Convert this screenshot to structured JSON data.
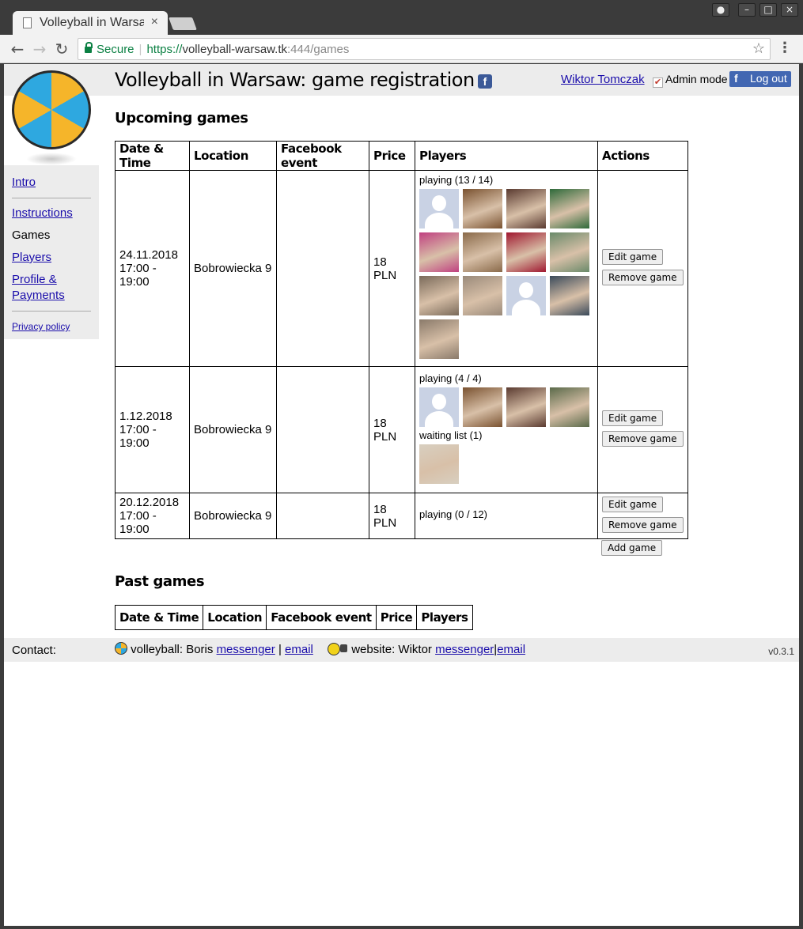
{
  "browser": {
    "tab_title": "Volleyball in Warsaw",
    "tab_close": "×",
    "secure_label": "Secure",
    "url_scheme": "https://",
    "url_host": "volleyball-warsaw.tk",
    "url_rest": ":444/games"
  },
  "header": {
    "title": "Volleyball in Warsaw: game registration",
    "fb_glyph": "f",
    "user_name": "Wiktor Tomczak",
    "admin_mode_label": "Admin mode",
    "admin_mode_checked": true,
    "logout_label": "Log out"
  },
  "sidebar": {
    "items": [
      {
        "label": "Intro"
      },
      {
        "label": "Instructions"
      },
      {
        "label": "Games"
      },
      {
        "label": "Players"
      },
      {
        "label": "Profile &"
      },
      {
        "label": "Payments"
      },
      {
        "label": "Privacy policy"
      }
    ]
  },
  "upcoming": {
    "title": "Upcoming games",
    "columns": [
      "Date & Time",
      "Location",
      "Facebook event",
      "Price",
      "Players",
      "Actions"
    ],
    "games": [
      {
        "date": "24.11.2018",
        "time": "17:00 - 19:00",
        "location": "Bobrowiecka 9",
        "facebook_event": "",
        "price": "18 PLN",
        "playing_label": "playing (13 / 14)",
        "avatars": [
          "#c9d2e4",
          "#7a5230",
          "#5a3a30",
          "#2e6a3a",
          "#c04080",
          "#8a6a4a",
          "#a01830",
          "#6a8a6a",
          "#7a6a5a",
          "#9a8a7a",
          "#c9d2e4",
          "#3a4a5a",
          "#8a7a6a"
        ],
        "edit_label": "Edit game",
        "remove_label": "Remove game"
      },
      {
        "date": "1.12.2018",
        "time": "17:00 - 19:00",
        "location": "Bobrowiecka 9",
        "facebook_event": "",
        "price": "18 PLN",
        "playing_label": "playing (4 / 4)",
        "avatars": [
          "#c9d2e4",
          "#7a5230",
          "#5a3a30",
          "#5a6a4a"
        ],
        "waiting_label": "waiting list (1)",
        "waiting_avatars": [
          "#d8cfc0"
        ],
        "edit_label": "Edit game",
        "remove_label": "Remove game"
      },
      {
        "date": "20.12.2018",
        "time": "17:00 - 19:00",
        "location": "Bobrowiecka 9",
        "facebook_event": "",
        "price": "18 PLN",
        "playing_label": "playing (0 / 12)",
        "avatars": [],
        "edit_label": "Edit game",
        "remove_label": "Remove game"
      }
    ],
    "add_game_label": "Add game"
  },
  "past": {
    "title": "Past games",
    "columns": [
      "Date & Time",
      "Location",
      "Facebook event",
      "Price",
      "Players"
    ]
  },
  "footer": {
    "contact_label": "Contact:",
    "volleyball_text": "volleyball: Boris",
    "boris_messenger": "messenger",
    "boris_email": "email",
    "pipe": "|",
    "website_text": "website: Wiktor",
    "wiktor_messenger": "messenger",
    "wiktor_email": "email",
    "version": "v0.3.1"
  }
}
